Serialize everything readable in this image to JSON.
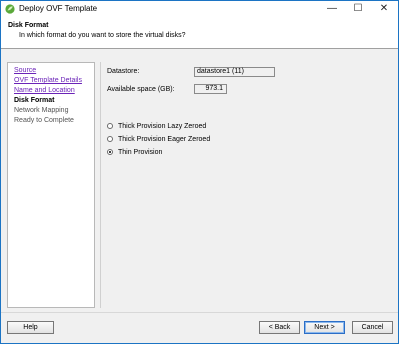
{
  "window": {
    "title": "Deploy OVF Template",
    "controls": {
      "minimize": "—",
      "maximize": "☐",
      "close": "✕"
    },
    "icon": "vsphere-leaf-icon",
    "accent_color": "#1c74c4"
  },
  "header": {
    "title": "Disk Format",
    "subtitle": "In which format do you want to store the virtual disks?"
  },
  "nav": {
    "items": [
      {
        "label": "Source",
        "state": "link"
      },
      {
        "label": "OVF Template Details",
        "state": "link"
      },
      {
        "label": "Name and Location",
        "state": "link"
      },
      {
        "label": "Disk Format",
        "state": "current"
      },
      {
        "label": "Network Mapping",
        "state": "pending"
      },
      {
        "label": "Ready to Complete",
        "state": "pending"
      }
    ]
  },
  "form": {
    "datastore_label": "Datastore:",
    "datastore_value": "datastore1 (11)",
    "available_label": "Available space (GB):",
    "available_value": "973.1",
    "provisioning": {
      "options": [
        {
          "label": "Thick Provision Lazy Zeroed",
          "checked": false
        },
        {
          "label": "Thick Provision Eager Zeroed",
          "checked": false
        },
        {
          "label": "Thin Provision",
          "checked": true
        }
      ]
    }
  },
  "footer": {
    "help": "Help",
    "back": "< Back",
    "next": "Next >",
    "cancel": "Cancel"
  }
}
